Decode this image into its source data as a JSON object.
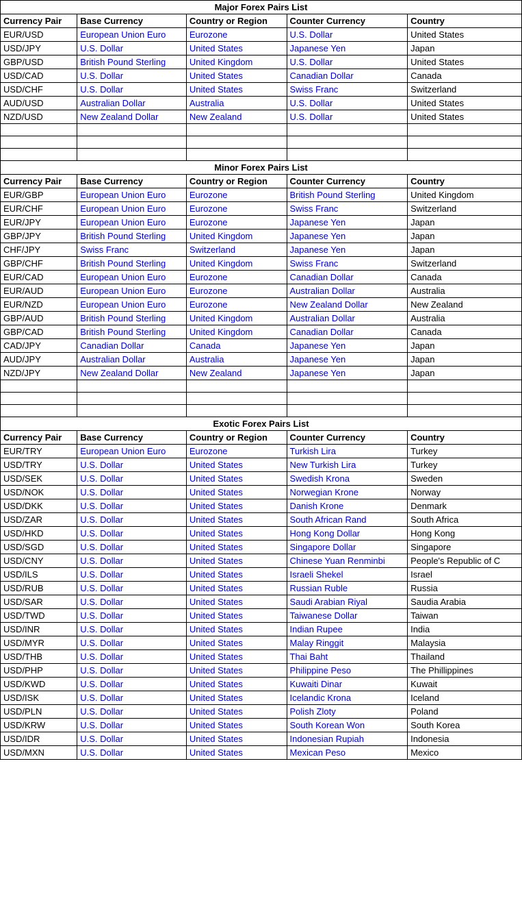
{
  "major": {
    "title": "Major Forex Pairs List",
    "headers": [
      "Currency Pair",
      "Base Currency",
      "Country or Region",
      "Counter Currency",
      "Country"
    ],
    "rows": [
      [
        "EUR/USD",
        "European Union Euro",
        "Eurozone",
        "U.S. Dollar",
        "United States"
      ],
      [
        "USD/JPY",
        "U.S. Dollar",
        "United States",
        "Japanese Yen",
        "Japan"
      ],
      [
        "GBP/USD",
        "British Pound Sterling",
        "United Kingdom",
        "U.S. Dollar",
        "United States"
      ],
      [
        "USD/CAD",
        "U.S. Dollar",
        "United States",
        "Canadian Dollar",
        "Canada"
      ],
      [
        "USD/CHF",
        "U.S. Dollar",
        "United States",
        "Swiss Franc",
        "Switzerland"
      ],
      [
        "AUD/USD",
        "Australian Dollar",
        "Australia",
        "U.S. Dollar",
        "United States"
      ],
      [
        "NZD/USD",
        "New Zealand Dollar",
        "New Zealand",
        "U.S. Dollar",
        "United States"
      ]
    ],
    "empty_rows": 3
  },
  "minor": {
    "title": "Minor Forex Pairs List",
    "headers": [
      "Currency Pair",
      "Base Currency",
      "Country or Region",
      "Counter Currency",
      "Country"
    ],
    "rows": [
      [
        "EUR/GBP",
        "European Union Euro",
        "Eurozone",
        "British Pound Sterling",
        "United Kingdom"
      ],
      [
        "EUR/CHF",
        "European Union Euro",
        "Eurozone",
        "Swiss Franc",
        "Switzerland"
      ],
      [
        "EUR/JPY",
        "European Union Euro",
        "Eurozone",
        "Japanese Yen",
        "Japan"
      ],
      [
        "GBP/JPY",
        "British Pound Sterling",
        "United Kingdom",
        "Japanese Yen",
        "Japan"
      ],
      [
        "CHF/JPY",
        "Swiss Franc",
        "Switzerland",
        "Japanese Yen",
        "Japan"
      ],
      [
        "GBP/CHF",
        "British Pound Sterling",
        "United Kingdom",
        "Swiss Franc",
        "Switzerland"
      ],
      [
        "EUR/CAD",
        "European Union Euro",
        "Eurozone",
        "Canadian Dollar",
        "Canada"
      ],
      [
        "EUR/AUD",
        "European Union Euro",
        "Eurozone",
        "Australian Dollar",
        "Australia"
      ],
      [
        "EUR/NZD",
        "European Union Euro",
        "Eurozone",
        "New Zealand Dollar",
        "New Zealand"
      ],
      [
        "GBP/AUD",
        "British Pound Sterling",
        "United Kingdom",
        "Australian Dollar",
        "Australia"
      ],
      [
        "GBP/CAD",
        "British Pound Sterling",
        "United Kingdom",
        "Canadian Dollar",
        "Canada"
      ],
      [
        "CAD/JPY",
        "Canadian Dollar",
        "Canada",
        "Japanese Yen",
        "Japan"
      ],
      [
        "AUD/JPY",
        "Australian Dollar",
        "Australia",
        "Japanese Yen",
        "Japan"
      ],
      [
        "NZD/JPY",
        "New Zealand Dollar",
        "New Zealand",
        "Japanese Yen",
        "Japan"
      ]
    ],
    "empty_rows": 3
  },
  "exotic": {
    "title": "Exotic Forex Pairs List",
    "headers": [
      "Currency Pair",
      "Base Currency",
      "Country or Region",
      "Counter Currency",
      "Country"
    ],
    "rows": [
      [
        "EUR/TRY",
        "European Union Euro",
        "Eurozone",
        "Turkish Lira",
        "Turkey"
      ],
      [
        "USD/TRY",
        "U.S. Dollar",
        "United States",
        "New Turkish Lira",
        "Turkey"
      ],
      [
        "USD/SEK",
        "U.S. Dollar",
        "United States",
        "Swedish Krona",
        "Sweden"
      ],
      [
        "USD/NOK",
        "U.S. Dollar",
        "United States",
        "Norwegian Krone",
        "Norway"
      ],
      [
        "USD/DKK",
        "U.S. Dollar",
        "United States",
        "Danish Krone",
        "Denmark"
      ],
      [
        "USD/ZAR",
        "U.S. Dollar",
        "United States",
        "South African Rand",
        "South Africa"
      ],
      [
        "USD/HKD",
        "U.S. Dollar",
        "United States",
        "Hong Kong Dollar",
        "Hong Kong"
      ],
      [
        "USD/SGD",
        "U.S. Dollar",
        "United States",
        "Singapore Dollar",
        "Singapore"
      ],
      [
        "USD/CNY",
        "U.S. Dollar",
        "United States",
        "Chinese Yuan Renminbi",
        "People's Republic of C"
      ],
      [
        "USD/ILS",
        "U.S. Dollar",
        "United States",
        "Israeli Shekel",
        "Israel"
      ],
      [
        "USD/RUB",
        "U.S. Dollar",
        "United States",
        "Russian Ruble",
        "Russia"
      ],
      [
        "USD/SAR",
        "U.S. Dollar",
        "United States",
        "Saudi Arabian Riyal",
        "Saudia Arabia"
      ],
      [
        "USD/TWD",
        "U.S. Dollar",
        "United States",
        "Taiwanese Dollar",
        "Taiwan"
      ],
      [
        "USD/INR",
        "U.S. Dollar",
        "United States",
        "Indian Rupee",
        "India"
      ],
      [
        "USD/MYR",
        "U.S. Dollar",
        "United States",
        "Malay Ringgit",
        "Malaysia"
      ],
      [
        "USD/THB",
        "U.S. Dollar",
        "United States",
        "Thai Baht",
        "Thailand"
      ],
      [
        "USD/PHP",
        "U.S. Dollar",
        "United States",
        "Philippine Peso",
        "The Phillippines"
      ],
      [
        "USD/KWD",
        "U.S. Dollar",
        "United States",
        "Kuwaiti Dinar",
        "Kuwait"
      ],
      [
        "USD/ISK",
        "U.S. Dollar",
        "United States",
        "Icelandic Krona",
        "Iceland"
      ],
      [
        "USD/PLN",
        "U.S. Dollar",
        "United States",
        "Polish Zloty",
        "Poland"
      ],
      [
        "USD/KRW",
        "U.S. Dollar",
        "United States",
        "South Korean Won",
        "South Korea"
      ],
      [
        "USD/IDR",
        "U.S. Dollar",
        "United States",
        "Indonesian Rupiah",
        "Indonesia"
      ],
      [
        "USD/MXN",
        "U.S. Dollar",
        "United States",
        "Mexican Peso",
        "Mexico"
      ]
    ]
  },
  "blue_regions": [
    "Eurozone",
    "United Kingdom",
    "Australia",
    "New Zealand",
    "United States",
    "Switzerland",
    "Canada",
    "Japan",
    "Turkey",
    "Sweden",
    "Norway",
    "Denmark",
    "South Africa",
    "Hong Kong",
    "Singapore",
    "People's Republic of C",
    "Israel",
    "Russia",
    "Saudia Arabia",
    "Taiwan",
    "India",
    "Malaysia",
    "Thailand",
    "The Phillippines",
    "Kuwait",
    "Iceland",
    "Poland",
    "South Korea",
    "Indonesia",
    "Mexico"
  ]
}
